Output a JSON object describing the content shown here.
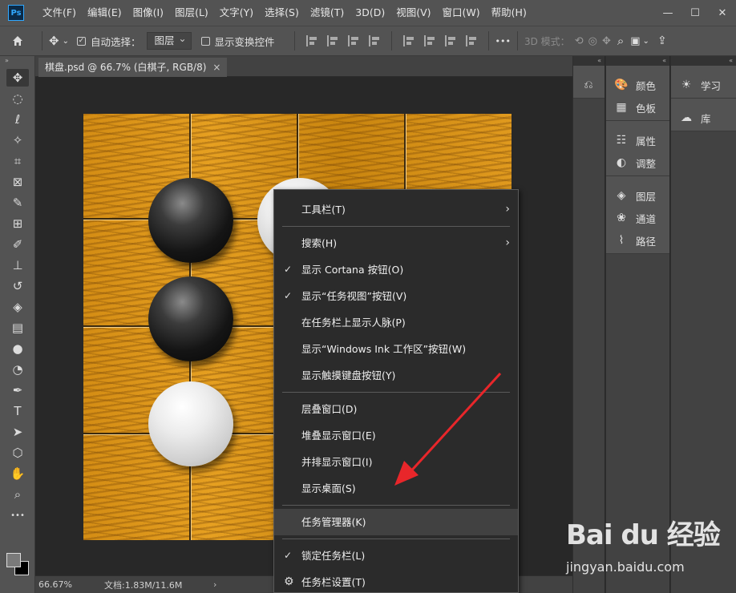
{
  "app": {
    "logo": "Ps"
  },
  "menu": [
    "文件(F)",
    "编辑(E)",
    "图像(I)",
    "图层(L)",
    "文字(Y)",
    "选择(S)",
    "滤镜(T)",
    "3D(D)",
    "视图(V)",
    "窗口(W)",
    "帮助(H)"
  ],
  "window_controls": {
    "minimize": "—",
    "maximize": "☐",
    "close": "✕"
  },
  "options": {
    "auto_select_label": "自动选择：",
    "auto_select_checked": true,
    "layer_select_value": "图层",
    "show_transform_label": "显示变换控件",
    "mode_3d_label": "3D 模式：",
    "more_label": "•••"
  },
  "document": {
    "tab_title": "棋盘.psd @ 66.7% (白棋子, RGB/8)",
    "tab_close": "×",
    "zoom": "66.67%",
    "doc_info": "文档:1.83M/11.6M",
    "status_arrow": "›"
  },
  "tools": [
    {
      "name": "move-tool",
      "glyph": "✥"
    },
    {
      "name": "marquee-tool",
      "glyph": "◌"
    },
    {
      "name": "lasso-tool",
      "glyph": "ℓ"
    },
    {
      "name": "magic-wand-tool",
      "glyph": "✧"
    },
    {
      "name": "crop-tool",
      "glyph": "⌗"
    },
    {
      "name": "frame-tool",
      "glyph": "⊠"
    },
    {
      "name": "eyedropper-tool",
      "glyph": "✎"
    },
    {
      "name": "patch-tool",
      "glyph": "⊞"
    },
    {
      "name": "brush-tool",
      "glyph": "✐"
    },
    {
      "name": "stamp-tool",
      "glyph": "⊥"
    },
    {
      "name": "history-brush-tool",
      "glyph": "↺"
    },
    {
      "name": "eraser-tool",
      "glyph": "◈"
    },
    {
      "name": "gradient-tool",
      "glyph": "▤"
    },
    {
      "name": "blur-tool",
      "glyph": "●"
    },
    {
      "name": "dodge-tool",
      "glyph": "◔"
    },
    {
      "name": "pen-tool",
      "glyph": "✒"
    },
    {
      "name": "type-tool",
      "glyph": "T"
    },
    {
      "name": "path-select-tool",
      "glyph": "➤"
    },
    {
      "name": "shape-tool",
      "glyph": "⬡"
    },
    {
      "name": "hand-tool",
      "glyph": "✋"
    },
    {
      "name": "zoom-tool",
      "glyph": "⌕"
    },
    {
      "name": "more-tools",
      "glyph": "•••"
    }
  ],
  "panels": {
    "mid_group1": [
      {
        "label": "颜色",
        "icon": "🎨"
      },
      {
        "label": "色板",
        "icon": "▦"
      }
    ],
    "mid_group2": [
      {
        "label": "属性",
        "icon": "☷"
      },
      {
        "label": "调整",
        "icon": "◐"
      }
    ],
    "mid_group3": [
      {
        "label": "图层",
        "icon": "◈"
      },
      {
        "label": "通道",
        "icon": "❀"
      },
      {
        "label": "路径",
        "icon": "⌇"
      }
    ],
    "right_group1": [
      {
        "label": "学习",
        "icon": "☀"
      }
    ],
    "right_group2": [
      {
        "label": "库",
        "icon": "☁"
      }
    ]
  },
  "context_menu": {
    "toolbar": "工具栏(T)",
    "search": "搜索(H)",
    "show_cortana": "显示 Cortana 按钮(O)",
    "show_taskview": "显示“任务视图”按钮(V)",
    "show_people": "在任务栏上显示人脉(P)",
    "show_ink": "显示“Windows Ink 工作区”按钮(W)",
    "show_keyboard": "显示触摸键盘按钮(Y)",
    "cascade": "层叠窗口(D)",
    "stack": "堆叠显示窗口(E)",
    "side_by_side": "并排显示窗口(I)",
    "show_desktop": "显示桌面(S)",
    "task_manager": "任务管理器(K)",
    "lock_taskbar": "锁定任务栏(L)",
    "taskbar_settings": "任务栏设置(T)",
    "check_glyph": "✓",
    "submenu_glyph": "›",
    "gear_glyph": "⚙"
  },
  "colors": {
    "arrow": "#e8262a",
    "menu_bg": "#2b2b2b",
    "ui_gray": "#535353"
  },
  "watermark": {
    "logo": "Bai du 经验",
    "url": "jingyan.baidu.com"
  }
}
